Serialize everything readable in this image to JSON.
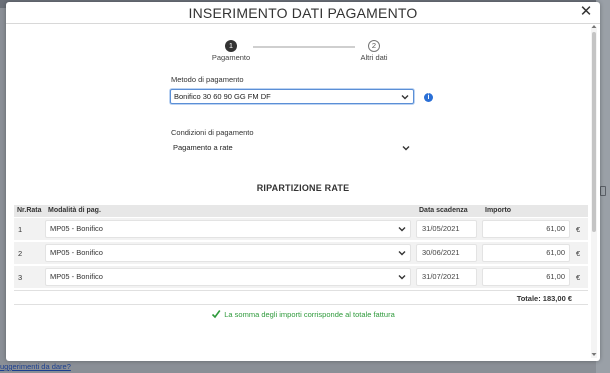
{
  "modal": {
    "title": "INSERIMENTO DATI PAGAMENTO",
    "close_glyph": "✕"
  },
  "stepper": {
    "steps": [
      {
        "number": "1",
        "label": "Pagamento",
        "state": "active"
      },
      {
        "number": "2",
        "label": "Altri dati",
        "state": "inactive"
      }
    ]
  },
  "payment_method": {
    "label": "Metodo di pagamento",
    "value": "Bonifico 30 60 90 GG FM DF"
  },
  "payment_terms": {
    "label": "Condizioni di pagamento",
    "value": "Pagamento a rate"
  },
  "installments": {
    "title": "RIPARTIZIONE RATE",
    "headers": {
      "number": "Nr.Rata",
      "mode": "Modalità di pag.",
      "due_date": "Data scadenza",
      "amount": "Importo"
    },
    "rows": [
      {
        "number": "1",
        "mode": "MP05 - Bonifico",
        "due_date": "31/05/2021",
        "amount": "61,00",
        "currency": "€"
      },
      {
        "number": "2",
        "mode": "MP05 - Bonifico",
        "due_date": "30/06/2021",
        "amount": "61,00",
        "currency": "€"
      },
      {
        "number": "3",
        "mode": "MP05 - Bonifico",
        "due_date": "31/07/2021",
        "amount": "61,00",
        "currency": "€"
      }
    ],
    "total": "Totale: 183,00 €"
  },
  "validation": {
    "message": "La somma degli importi corrisponde al totale fattura",
    "color": "#2e9a3b"
  },
  "background": {
    "link_text": "uggerimenti da dare?"
  },
  "colors": {
    "accent": "#2a6fd6",
    "active_step": "#333333",
    "success": "#2e9a3b"
  },
  "icons": {
    "close": "close-icon",
    "info": "info-icon",
    "chevron": "chevron-down-icon",
    "check": "check-icon"
  }
}
